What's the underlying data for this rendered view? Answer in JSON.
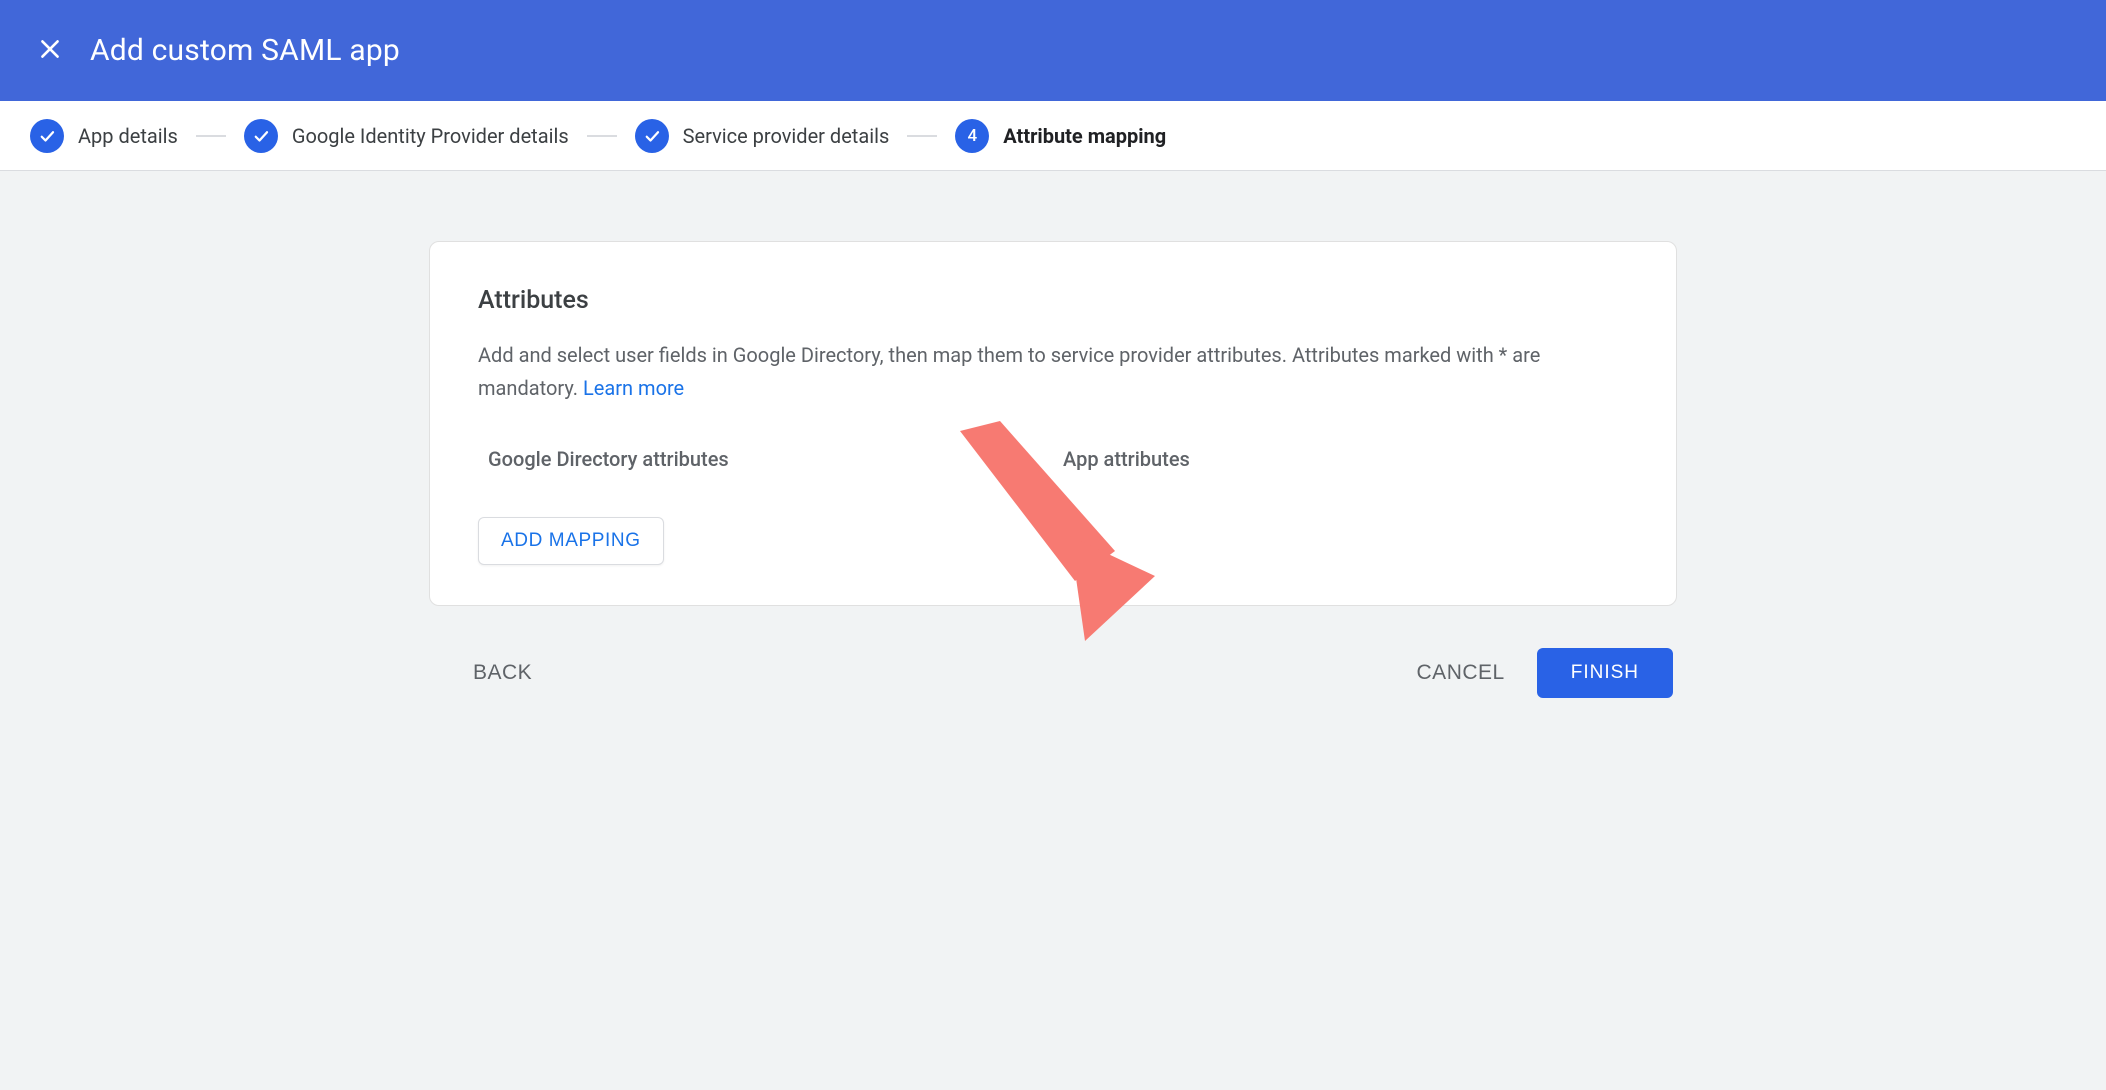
{
  "header": {
    "title": "Add custom SAML app"
  },
  "stepper": {
    "steps": [
      {
        "label": "App details",
        "done": true
      },
      {
        "label": "Google Identity Provider details",
        "done": true
      },
      {
        "label": "Service provider details",
        "done": true
      },
      {
        "label": "Attribute mapping",
        "number": "4",
        "current": true
      }
    ]
  },
  "card": {
    "heading": "Attributes",
    "description_prefix": "Add and select user fields in Google Directory, then map them to service provider attributes. Attributes marked with * are mandatory. ",
    "learn_more": "Learn more",
    "col_left_head": "Google Directory attributes",
    "col_right_head": "App attributes",
    "add_mapping_label": "ADD MAPPING"
  },
  "footer": {
    "back": "BACK",
    "cancel": "CANCEL",
    "finish": "FINISH"
  }
}
